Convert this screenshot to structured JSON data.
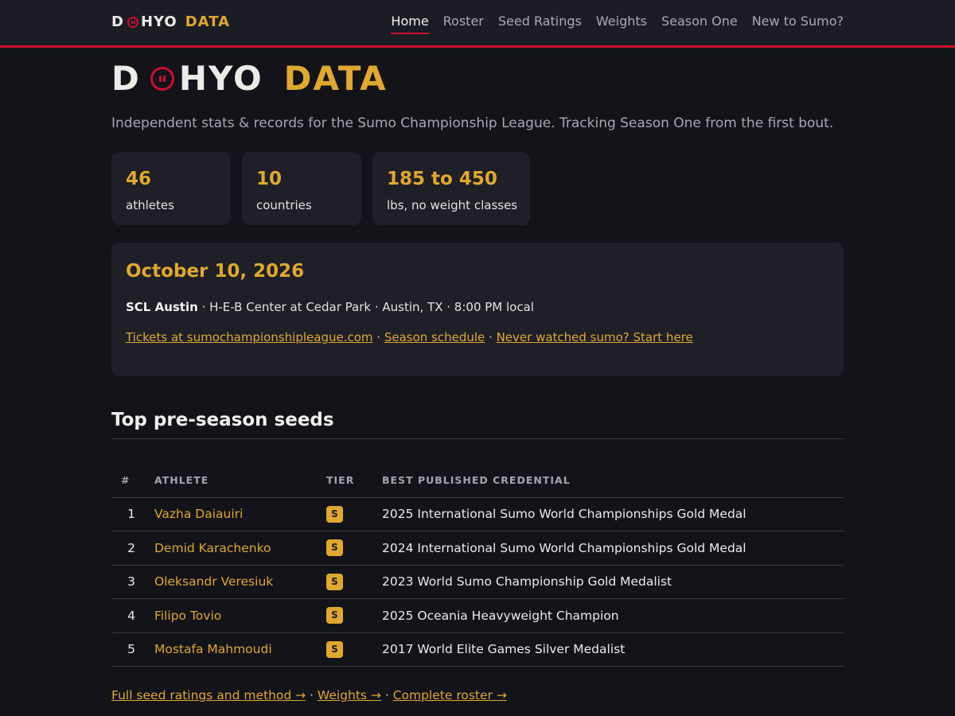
{
  "brand": {
    "left": "D",
    "right": "HYO",
    "accent": "DATA",
    "ring_icon": "ring-icon"
  },
  "nav": {
    "items": [
      {
        "label": "Home",
        "active": true
      },
      {
        "label": "Roster"
      },
      {
        "label": "Seed Ratings"
      },
      {
        "label": "Weights"
      },
      {
        "label": "Season One"
      },
      {
        "label": "New to Sumo?"
      }
    ]
  },
  "hero": {
    "tagline": "Independent stats & records for the Sumo Championship League. Tracking Season One from the first bout."
  },
  "stats": [
    {
      "value": "46",
      "label": "athletes"
    },
    {
      "value": "10",
      "label": "countries"
    },
    {
      "value": "185 to 450",
      "label": "lbs, no weight classes"
    }
  ],
  "event": {
    "date": "October 10, 2026",
    "name": "SCL Austin",
    "details": " · H-E-B Center at Cedar Park · Austin, TX · 8:00 PM local",
    "links": [
      "Tickets at sumochampionshipleague.com",
      "Season schedule",
      "Never watched sumo? Start here"
    ],
    "separator": " · "
  },
  "seeds": {
    "title": "Top pre-season seeds",
    "columns": [
      "#",
      "ATHLETE",
      "TIER",
      "BEST PUBLISHED CREDENTIAL"
    ],
    "rows": [
      {
        "num": "1",
        "athlete": "Vazha Daiauiri",
        "tier": "S",
        "credential": "2025 International Sumo World Championships Gold Medal"
      },
      {
        "num": "2",
        "athlete": "Demid Karachenko",
        "tier": "S",
        "credential": "2024 International Sumo World Championships Gold Medal"
      },
      {
        "num": "3",
        "athlete": "Oleksandr Veresiuk",
        "tier": "S",
        "credential": "2023 World Sumo Championship Gold Medalist"
      },
      {
        "num": "4",
        "athlete": "Filipo Tovio",
        "tier": "S",
        "credential": "2025 Oceania Heavyweight Champion"
      },
      {
        "num": "5",
        "athlete": "Mostafa Mahmoudi",
        "tier": "S",
        "credential": "2017 World Elite Games Silver Medalist"
      }
    ]
  },
  "footer": {
    "links": [
      "Full seed ratings and method →",
      "Weights →",
      "Complete roster →"
    ],
    "separator": " · "
  },
  "colors": {
    "accent": "#e0a82e",
    "brand_red": "#c8102e",
    "background": "#13131a",
    "card": "#1e1f27"
  }
}
